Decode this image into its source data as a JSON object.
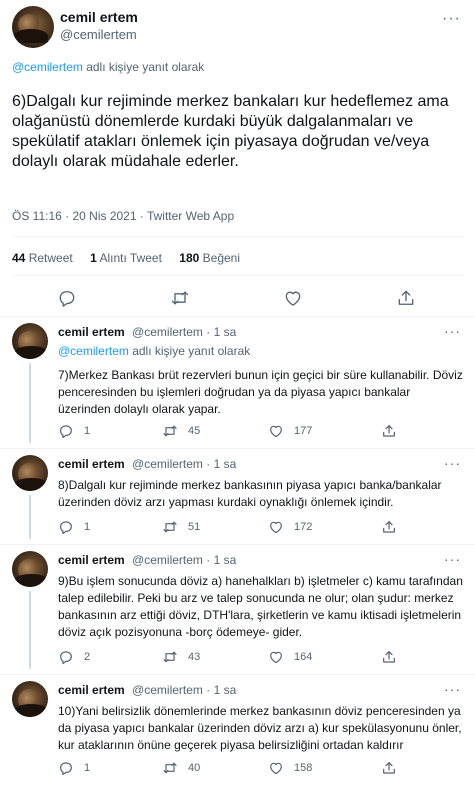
{
  "main_tweet": {
    "author_name": "cemil ertem",
    "author_handle": "@cemilertem",
    "more_label": "···",
    "replying_mention": "@cemilertem",
    "replying_suffix": "adlı kişiye yanıt olarak",
    "text": "6)Dalgalı kur rejiminde merkez bankaları kur hedeflemez ama olağanüstü dönemlerde kurdaki büyük dalgalanmaları ve spekülatif atakları önlemek için piyasaya doğrudan ve/veya dolaylı olarak müdahale ederler.",
    "timestamp": "ÖS 11:16 · 20 Nis 2021 · Twitter Web App",
    "stats": {
      "retweet_count": "44",
      "retweet_label": "Retweet",
      "quote_count": "1",
      "quote_label": "Alıntı Tweet",
      "like_count": "180",
      "like_label": "Beğeni"
    }
  },
  "replies": [
    {
      "author_name": "cemil ertem",
      "author_handle": "@cemilertem",
      "time": "· 1 sa",
      "more_label": "···",
      "replying_mention": "@cemilertem",
      "replying_suffix": "adlı kişiye yanıt olarak",
      "text": "7)Merkez Bankası brüt rezervleri bunun için geçici bir süre kullanabilir. Döviz penceresinden bu işlemleri doğrudan ya da piyasa yapıcı bankalar üzerinden dolaylı olarak yapar.",
      "reply_count": "1",
      "retweet_count": "45",
      "like_count": "177"
    },
    {
      "author_name": "cemil ertem",
      "author_handle": "@cemilertem",
      "time": "· 1 sa",
      "more_label": "···",
      "text": "8)Dalgalı kur rejiminde merkez bankasının piyasa yapıcı banka/bankalar üzerinden döviz arzı yapması kurdaki oynaklığı önlemek içindir.",
      "reply_count": "1",
      "retweet_count": "51",
      "like_count": "172"
    },
    {
      "author_name": "cemil ertem",
      "author_handle": "@cemilertem",
      "time": "· 1 sa",
      "more_label": "···",
      "text": "9)Bu işlem sonucunda döviz a) hanehalkları b) işletmeler c) kamu tarafından talep edilebilir. Peki bu arz ve talep sonucunda ne olur; olan şudur: merkez bankasının arz ettiği döviz, DTH'lara, şirketlerin ve kamu iktisadi işletmelerin döviz açık pozisyonuna -borç ödemeye- gider.",
      "reply_count": "2",
      "retweet_count": "43",
      "like_count": "164"
    },
    {
      "author_name": "cemil ertem",
      "author_handle": "@cemilertem",
      "time": "· 1 sa",
      "more_label": "···",
      "text": "10)Yani belirsizlik dönemlerinde merkez bankasının döviz penceresinden ya da piyasa yapıcı bankalar üzerinden döviz arzı a) kur spekülasyonunu önler, kur ataklarının önüne geçerek piyasa belirsizliğini ortadan kaldırır",
      "reply_count": "1",
      "retweet_count": "40",
      "like_count": "158"
    }
  ],
  "icons": [
    "reply-icon",
    "retweet-icon",
    "like-icon",
    "share-icon"
  ],
  "colors": {
    "accent": "#1d9bf0",
    "secondary_text": "#536471",
    "border": "#eff3f4"
  }
}
